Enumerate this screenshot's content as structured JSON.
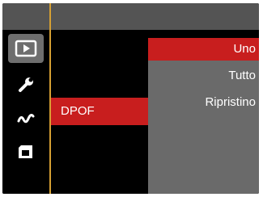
{
  "sidebar": {
    "items": [
      {
        "icon": "playback-icon",
        "active": true
      },
      {
        "icon": "wrench-icon",
        "active": false
      },
      {
        "icon": "wave-icon",
        "active": false
      },
      {
        "icon": "sd-card-icon",
        "active": false
      }
    ]
  },
  "menu": {
    "rows": [
      {
        "label": "",
        "selected": false
      },
      {
        "label": "",
        "selected": false
      },
      {
        "label": "DPOF",
        "selected": true
      },
      {
        "label": "",
        "selected": false
      },
      {
        "label": "",
        "selected": false
      }
    ]
  },
  "submenu": {
    "options": [
      {
        "label": "Uno",
        "selected": true
      },
      {
        "label": "Tutto",
        "selected": false
      },
      {
        "label": "Ripristino",
        "selected": false
      }
    ]
  },
  "colors": {
    "accent": "#c81e1e",
    "line": "#d6a033",
    "panel": "#6a6a6a",
    "header": "#545454"
  }
}
